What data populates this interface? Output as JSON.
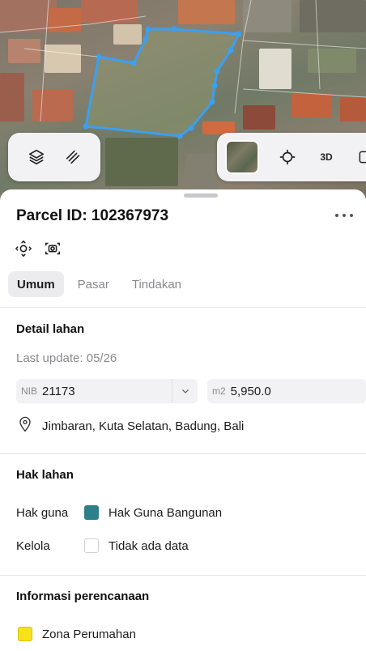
{
  "map": {
    "layers_icon": "layers-icon",
    "draw_icon": "draw-icon",
    "locate_icon": "crosshair-icon",
    "mode_3d_label": "3D"
  },
  "parcel": {
    "title": "Parcel ID: 102367973",
    "more_icon": "more-horizontal-icon"
  },
  "tools": [
    "focus-icon",
    "camera-icon"
  ],
  "tabs": [
    {
      "label": "Umum",
      "active": true
    },
    {
      "label": "Pasar",
      "active": false
    },
    {
      "label": "Tindakan",
      "active": false
    }
  ],
  "detail": {
    "title": "Detail lahan",
    "last_update": "Last update: 05/26",
    "nib_prefix": "NIB",
    "nib_value": "21173",
    "area_prefix": "m2",
    "area_value": "5,950.0",
    "location": "Jimbaran, Kuta Selatan, Badung, Bali"
  },
  "hak": {
    "title": "Hak lahan",
    "rows": [
      {
        "label": "Hak guna",
        "value": "Hak Guna Bangunan",
        "color": "#2f7f8a"
      },
      {
        "label": "Kelola",
        "value": "Tidak ada data",
        "color": "#ffffff"
      }
    ]
  },
  "planning": {
    "title": "Informasi perencanaan",
    "zone": "Zona Perumahan",
    "zone_color": "#f5e21b"
  },
  "colors": {
    "parcel_outline": "#3aa0f0",
    "tab_active_bg": "#ececee"
  }
}
